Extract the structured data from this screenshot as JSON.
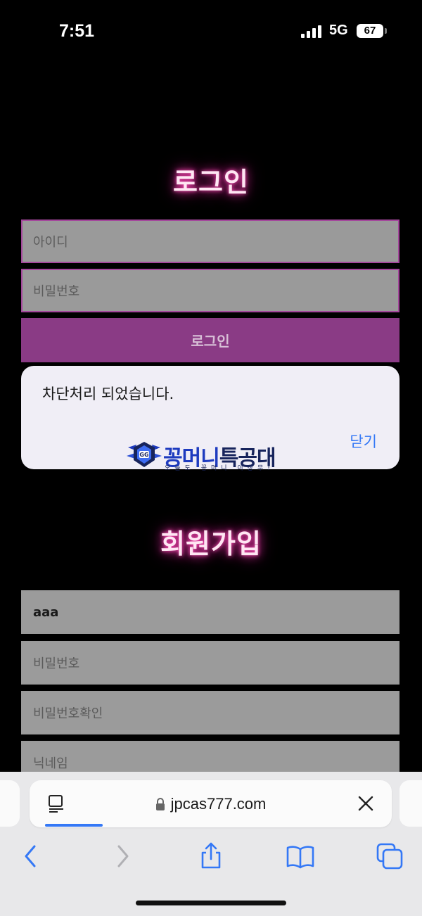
{
  "status_bar": {
    "time": "7:51",
    "network": "5G",
    "battery": "67"
  },
  "login": {
    "title": "로그인",
    "id_placeholder": "아이디",
    "password_placeholder": "비밀번호",
    "button_label": "로그인"
  },
  "alert": {
    "message": "차단처리 되었습니다.",
    "close_label": "닫기",
    "logo_brand_a": "꽁머니",
    "logo_brand_b": "특공대",
    "logo_tagline": "오늘도 꽁머니 이상무!"
  },
  "signup": {
    "title": "회원가입",
    "id_value": "aaa",
    "password_placeholder": "비밀번호",
    "password_confirm_placeholder": "비밀번호확인",
    "nickname_placeholder": "닉네임"
  },
  "browser": {
    "url": "jpcas777.com"
  },
  "colors": {
    "accent_purple": "#8a3b85",
    "input_border": "#a4479c",
    "title_glow": "#ff4fb6",
    "ios_blue": "#3478f6"
  }
}
